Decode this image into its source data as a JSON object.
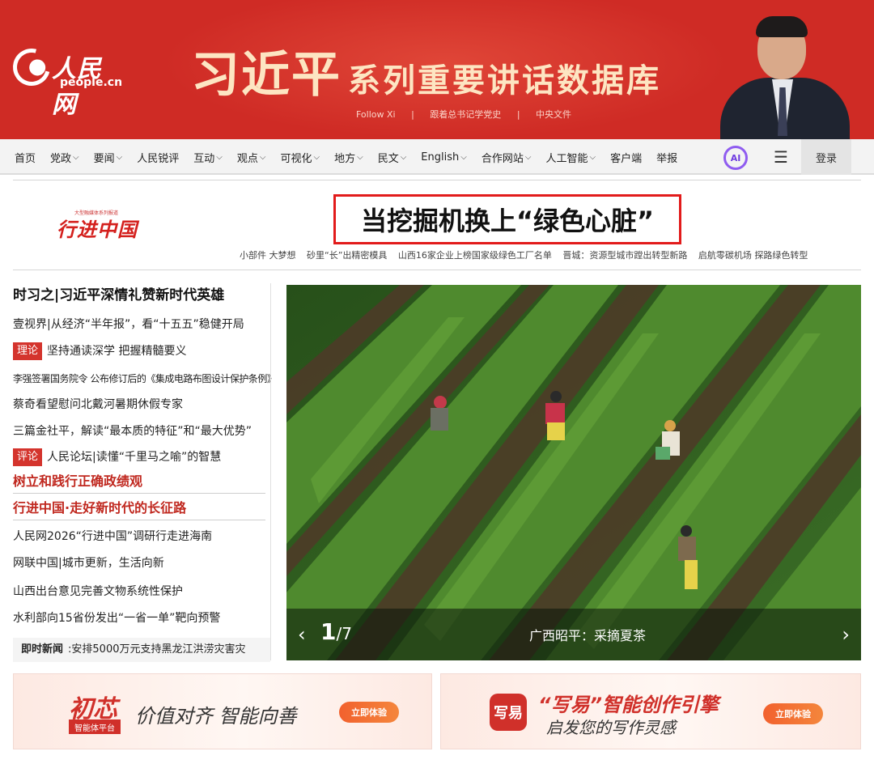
{
  "banner": {
    "logo_cn": "人民网",
    "logo_en": "people.cn",
    "title_big": "习近平",
    "title_rest": "系列重要讲话数据库",
    "links": [
      "Follow Xi",
      "|",
      "跟着总书记学党史",
      "|",
      "中央文件"
    ]
  },
  "nav": {
    "items": [
      {
        "label": "首页",
        "chevron": false
      },
      {
        "label": "党政",
        "chevron": true
      },
      {
        "label": "要闻",
        "chevron": true
      },
      {
        "label": "人民锐评",
        "chevron": false
      },
      {
        "label": "互动",
        "chevron": true
      },
      {
        "label": "观点",
        "chevron": true
      },
      {
        "label": "可视化",
        "chevron": true
      },
      {
        "label": "地方",
        "chevron": true
      },
      {
        "label": "民文",
        "chevron": true
      },
      {
        "label": "English",
        "chevron": true
      },
      {
        "label": "合作网站",
        "chevron": true
      },
      {
        "label": "人工智能",
        "chevron": true
      },
      {
        "label": "客户端",
        "chevron": false
      },
      {
        "label": "举报",
        "chevron": false
      }
    ],
    "ai_label": "AI",
    "menu_icon": "☰",
    "login": "登录"
  },
  "feature": {
    "logo_small": "大型融媒体系列报道",
    "logo_main": "行进中国",
    "headline": "当挖掘机换上“绿色心脏”",
    "sub_links": [
      "小部件 大梦想",
      "砂里“长”出精密模具",
      "山西16家企业上榜国家级绿色工厂名单",
      "晋城：资源型城市蹚出转型新路",
      "启航零碳机场 探路绿色转型"
    ]
  },
  "left": {
    "lead": "时习之|习近平深情礼赞新时代英雄",
    "news1": "壹视界|从经济“半年报”，看“十五五”稳健开局",
    "tag_theory": "理论",
    "news2": "坚持通读深学 把握精髓要义",
    "news3": "李强签署国务院令 公布修订后的《集成电路布图设计保护条例》",
    "news4": "蔡奇看望慰问北戴河暑期休假专家",
    "news5": "三篇金社平，解读“最本质的特征”和“最大优势”",
    "tag_comment": "评论",
    "news6": "人民论坛|读懂“千里马之喻”的智慧",
    "red1": "树立和践行正确政绩观",
    "red2": "行进中国·走好新时代的长征路",
    "news7": "人民网2026“行进中国”调研行走进海南",
    "news8": "网联中国|城市更新，生活向新",
    "news9": "山西出台意见完善文物系统性保护",
    "news10": "水利部向15省份发出“一省一单”靶向预警",
    "ticker_label": "即时新闻",
    "ticker_text": ":安排5000万元支持黑龙江洪涝灾害灾"
  },
  "carousel": {
    "current": "1",
    "total": "/7",
    "caption": "广西昭平：采摘夏茶",
    "prev": "‹",
    "next": "›"
  },
  "ads": {
    "ad1_brand": "初芯",
    "ad1_badge": "智能体平台",
    "ad1_slogan": "价值对齐 智能向善",
    "ad1_btn": "立即体验",
    "ad2_mark": "写易",
    "ad2_brand": "“写易”智能创作引擎",
    "ad2_slogan": "启发您的写作灵感",
    "ad2_btn": "立即体验"
  }
}
